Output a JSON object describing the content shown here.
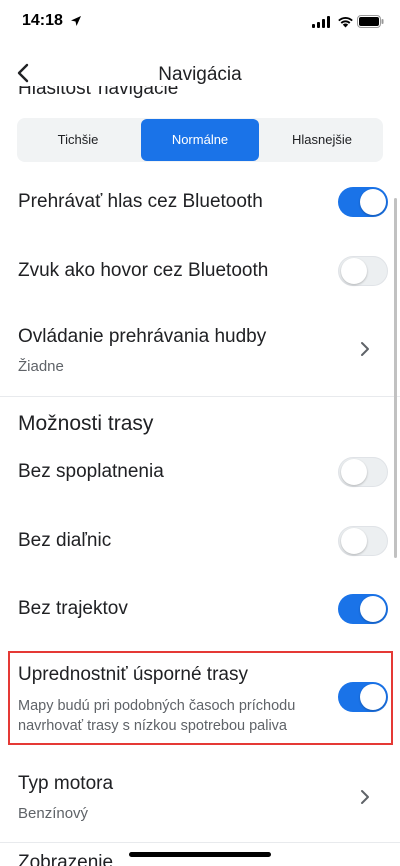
{
  "status_bar": {
    "time": "14:18"
  },
  "header": {
    "title": "Navigácia"
  },
  "partial_top_label": "Hlasitosť navigácie",
  "volume_segments": [
    {
      "label": "Tichšie",
      "selected": false
    },
    {
      "label": "Normálne",
      "selected": true
    },
    {
      "label": "Hlasnejšie",
      "selected": false
    }
  ],
  "settings": {
    "bluetooth_voice": {
      "label": "Prehrávať hlas cez Bluetooth",
      "on": true
    },
    "bluetooth_call": {
      "label": "Zvuk ako hovor cez Bluetooth",
      "on": false
    },
    "music_control": {
      "label": "Ovládanie prehrávania hudby",
      "value": "Žiadne"
    }
  },
  "route_options": {
    "title": "Možnosti trasy",
    "avoid_tolls": {
      "label": "Bez spoplatnenia",
      "on": false
    },
    "avoid_highways": {
      "label": "Bez diaľnic",
      "on": false
    },
    "avoid_ferries": {
      "label": "Bez trajektov",
      "on": true
    },
    "eco_routes": {
      "label": "Uprednostniť úsporné trasy",
      "description": "Mapy budú pri podobných časoch príchodu navrhovať trasy s nízkou spotrebou paliva",
      "on": true
    },
    "engine_type": {
      "label": "Typ motora",
      "value": "Benzínový"
    }
  },
  "partial_bottom_label": "Zobrazenie",
  "colors": {
    "accent": "#1a73e8",
    "highlight_border": "#e53935"
  }
}
